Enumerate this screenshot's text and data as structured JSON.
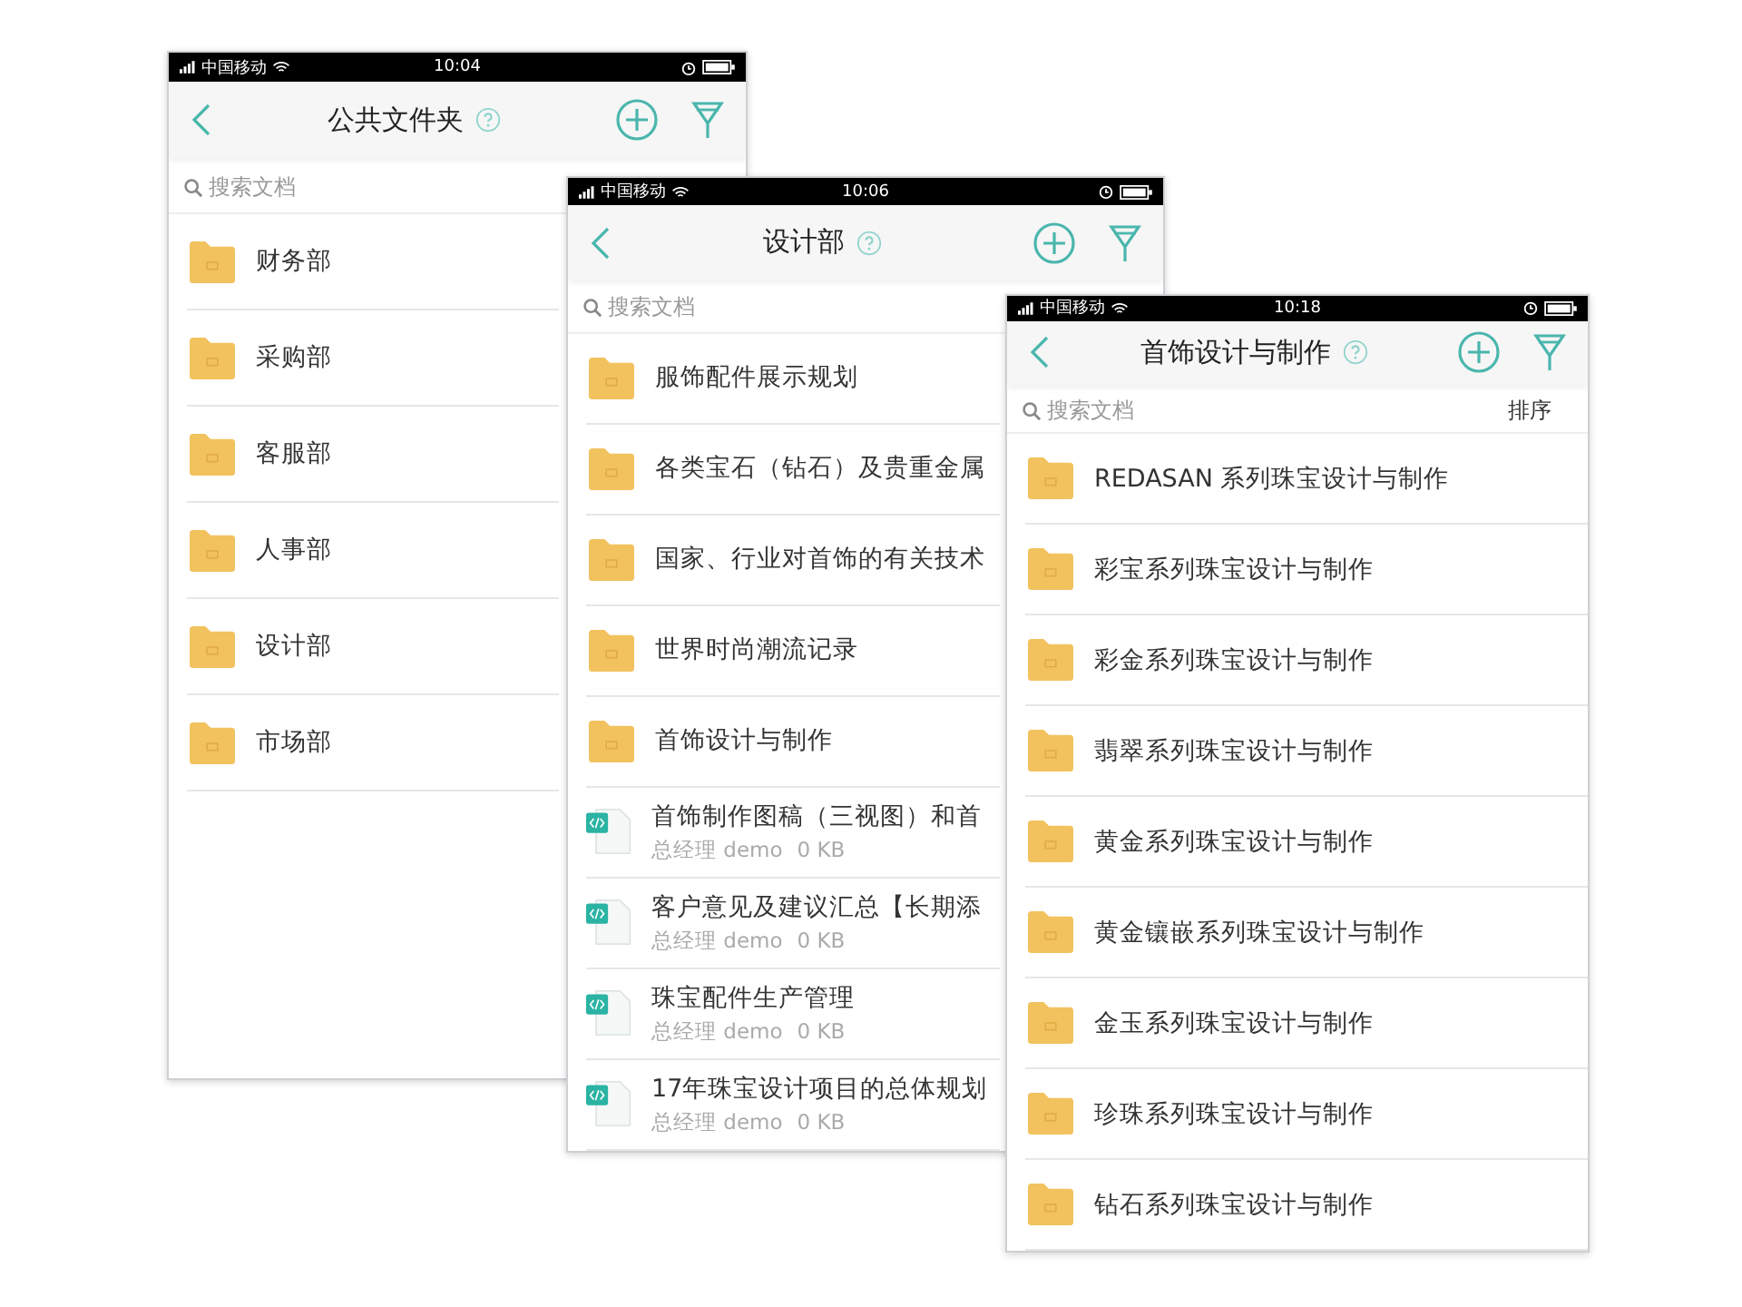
{
  "phones": [
    {
      "status_bar": {
        "carrier": "中国移动",
        "time": "10:04"
      },
      "title": "公共文件夹",
      "search": {
        "placeholder": "搜索文档"
      },
      "items": [
        {
          "kind": "folder",
          "name": "财务部"
        },
        {
          "kind": "folder",
          "name": "采购部"
        },
        {
          "kind": "folder",
          "name": "客服部"
        },
        {
          "kind": "folder",
          "name": "人事部"
        },
        {
          "kind": "folder",
          "name": "设计部"
        },
        {
          "kind": "folder",
          "name": "市场部"
        }
      ]
    },
    {
      "status_bar": {
        "carrier": "中国移动",
        "time": "10:06"
      },
      "title": "设计部",
      "search": {
        "placeholder": "搜索文档"
      },
      "items": [
        {
          "kind": "folder",
          "name": "服饰配件展示规划"
        },
        {
          "kind": "folder",
          "name": "各类宝石（钻石）及贵重金属"
        },
        {
          "kind": "folder",
          "name": "国家、行业对首饰的有关技术"
        },
        {
          "kind": "folder",
          "name": "世界时尚潮流记录"
        },
        {
          "kind": "folder",
          "name": "首饰设计与制作"
        },
        {
          "kind": "file",
          "name": "首饰制作图稿（三视图）和首",
          "owner": "总经理 demo",
          "size": "0 KB"
        },
        {
          "kind": "file",
          "name": "客户意见及建议汇总【长期添",
          "owner": "总经理 demo",
          "size": "0 KB"
        },
        {
          "kind": "file",
          "name": "珠宝配件生产管理",
          "owner": "总经理 demo",
          "size": "0 KB"
        },
        {
          "kind": "file",
          "name": "17年珠宝设计项目的总体规划",
          "owner": "总经理 demo",
          "size": "0 KB"
        }
      ]
    },
    {
      "status_bar": {
        "carrier": "中国移动",
        "time": "10:18"
      },
      "title": "首饰设计与制作",
      "search": {
        "placeholder": "搜索文档"
      },
      "sort_label": "排序",
      "items": [
        {
          "kind": "folder",
          "name": "REDASAN 系列珠宝设计与制作"
        },
        {
          "kind": "folder",
          "name": "彩宝系列珠宝设计与制作"
        },
        {
          "kind": "folder",
          "name": "彩金系列珠宝设计与制作"
        },
        {
          "kind": "folder",
          "name": "翡翠系列珠宝设计与制作"
        },
        {
          "kind": "folder",
          "name": "黄金系列珠宝设计与制作"
        },
        {
          "kind": "folder",
          "name": "黄金镶嵌系列珠宝设计与制作"
        },
        {
          "kind": "folder",
          "name": "金玉系列珠宝设计与制作"
        },
        {
          "kind": "folder",
          "name": "珍珠系列珠宝设计与制作"
        },
        {
          "kind": "folder",
          "name": "钻石系列珠宝设计与制作"
        }
      ]
    }
  ]
}
